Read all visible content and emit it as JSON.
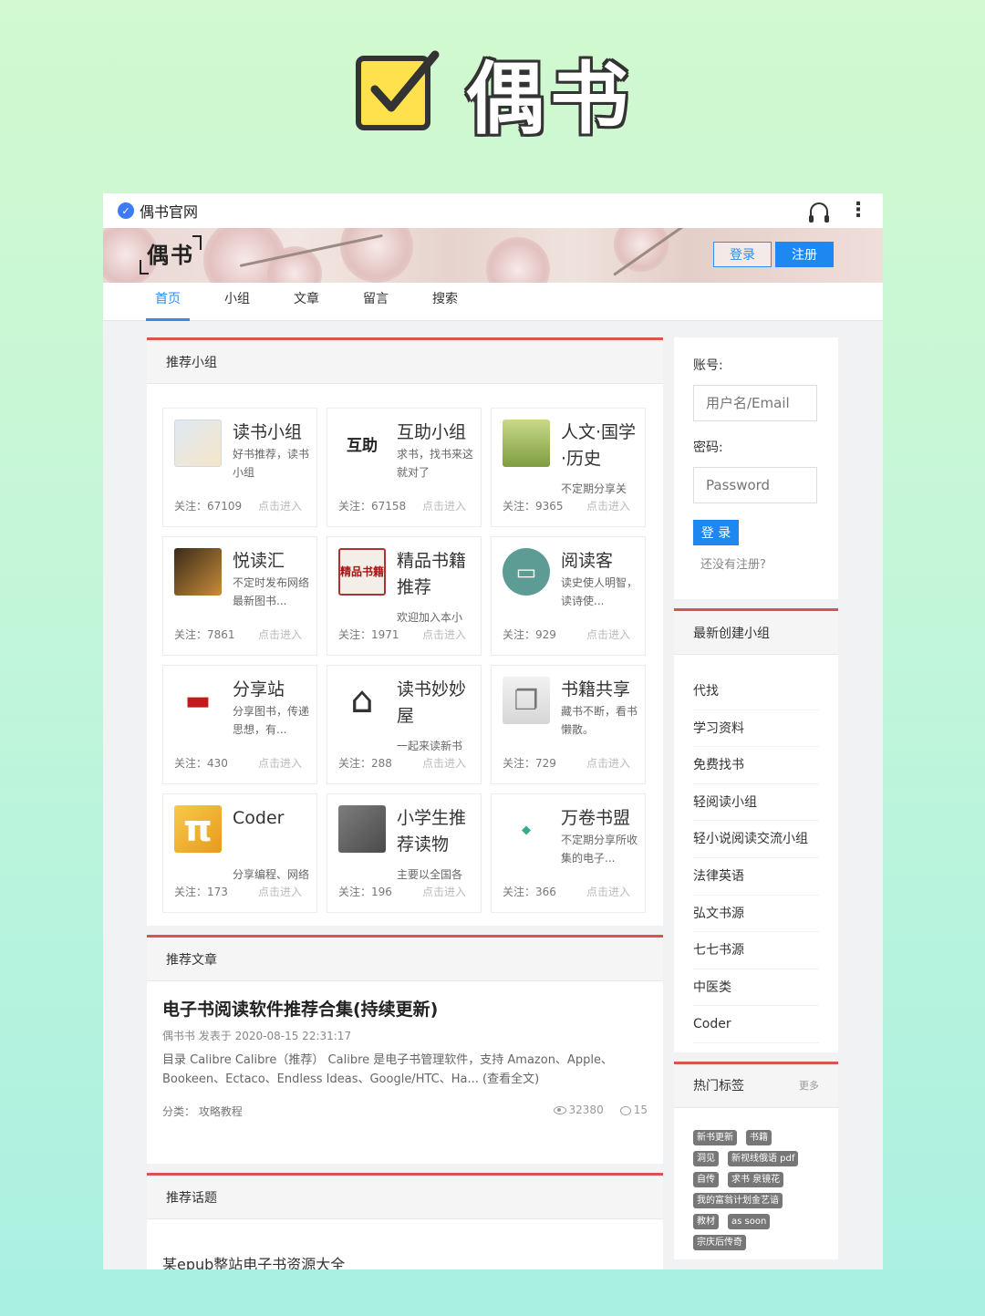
{
  "poster": {
    "title": "偶书"
  },
  "topbar": {
    "site_name": "偶书官网"
  },
  "banner": {
    "brand": "偶书",
    "login_label": "登录",
    "register_label": "注册"
  },
  "nav": {
    "items": [
      "首页",
      "小组",
      "文章",
      "留言",
      "搜索"
    ]
  },
  "recommended_groups": {
    "heading": "推荐小组",
    "follow_prefix": "关注：",
    "enter_label": "点击进入",
    "items": [
      {
        "name": "读书小组",
        "desc": "好书推荐，读书小组",
        "follows": "67109"
      },
      {
        "name": "互助小组",
        "desc": "求书，找书来这就对了",
        "follows": "67158"
      },
      {
        "name": "人文·国学·历史",
        "desc": "不定期分享关",
        "follows": "9365"
      },
      {
        "name": "悦读汇",
        "desc": "不定时发布网络最新图书...",
        "follows": "7861"
      },
      {
        "name": "精品书籍推荐",
        "desc": "欢迎加入本小",
        "follows": "1971"
      },
      {
        "name": "阅读客",
        "desc": "读史使人明智，读诗使...",
        "follows": "929"
      },
      {
        "name": "分享站",
        "desc": "分享图书，传递思想，有...",
        "follows": "430"
      },
      {
        "name": "读书妙妙屋",
        "desc": "一起来读新书",
        "follows": "288"
      },
      {
        "name": "书籍共享",
        "desc": "藏书不断，看书懒散。",
        "follows": "729"
      },
      {
        "name": "Coder",
        "desc": "分享编程、网络安全书籍...",
        "follows": "173"
      },
      {
        "name": "小学生推荐读物",
        "desc": "主要以全国各",
        "follows": "196"
      },
      {
        "name": "万卷书盟",
        "desc": "不定期分享所收集的电子...",
        "follows": "366"
      }
    ]
  },
  "recommended_articles": {
    "heading": "推荐文章",
    "title": "电子书阅读软件推荐合集(持续更新)",
    "meta": "偶书书 发表于 2020-08-15 22:31:17",
    "excerpt": "目录 Calibre   Calibre（推荐） Calibre 是电子书管理软件，支持 Amazon、Apple、Bookeen、Ectaco、Endless Ideas、Google/HTC、Ha... (查看全文)",
    "category": "分类： 攻略教程",
    "views": "32380",
    "comments": "15"
  },
  "recommended_topics": {
    "heading": "推荐话题",
    "first_topic": "某epub整站电子书资源大全"
  },
  "login_box": {
    "account_label": "账号:",
    "account_placeholder": "用户名/Email",
    "password_label": "密码:",
    "password_placeholder": "Password",
    "login_button": "登 录",
    "register_link": "还没有注册?"
  },
  "new_groups": {
    "heading": "最新创建小组",
    "items": [
      "代找",
      "学习资料",
      "免费找书",
      "轻阅读小组",
      "轻小说阅读交流小组",
      "法律英语",
      "弘文书源",
      "七七书源",
      "中医类",
      "Coder"
    ]
  },
  "hot_tags": {
    "heading": "热门标签",
    "more": "更多",
    "items": [
      "新书更新",
      "书籍",
      "洞见",
      "新视线俄语 pdf",
      "自传",
      "求书 泉镜花",
      "我的富翁计划金艺谙",
      "教材",
      "as soon",
      "宗庆后传奇"
    ]
  },
  "colors": {
    "accent_blue": "#1e88f0",
    "panel_red": "#d9534f"
  }
}
